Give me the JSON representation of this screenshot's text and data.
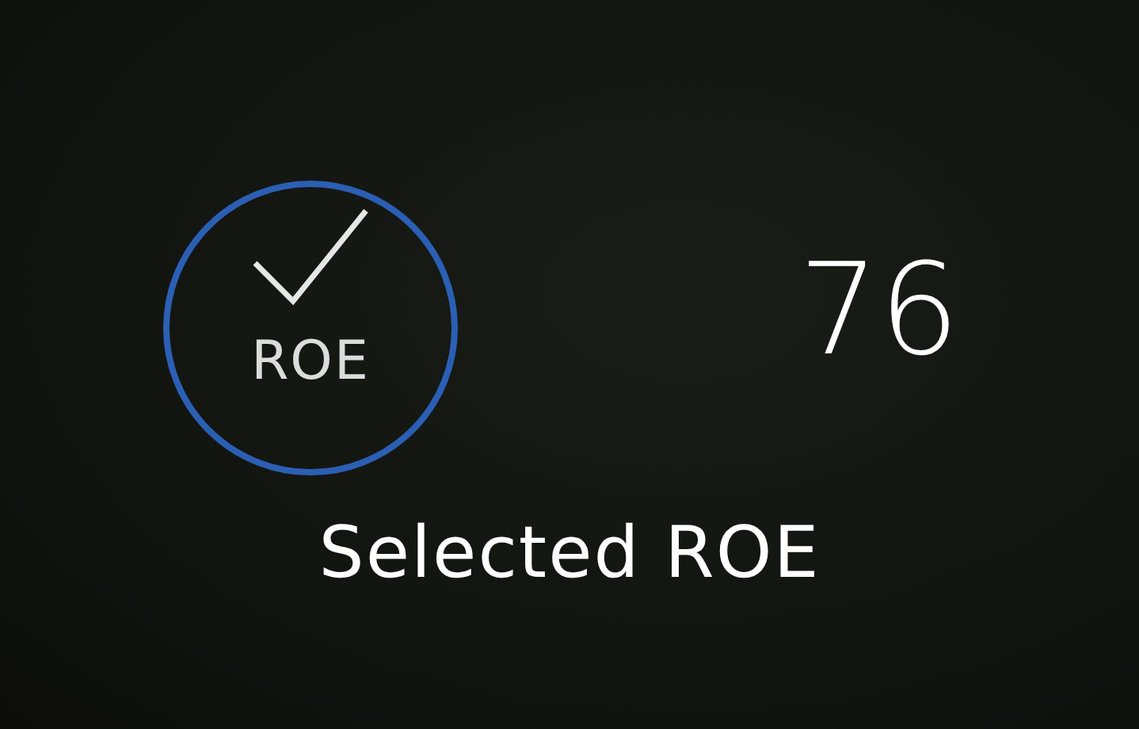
{
  "badge": {
    "label": "ROE",
    "checked": true
  },
  "value": "76",
  "caption": "Selected ROE"
}
